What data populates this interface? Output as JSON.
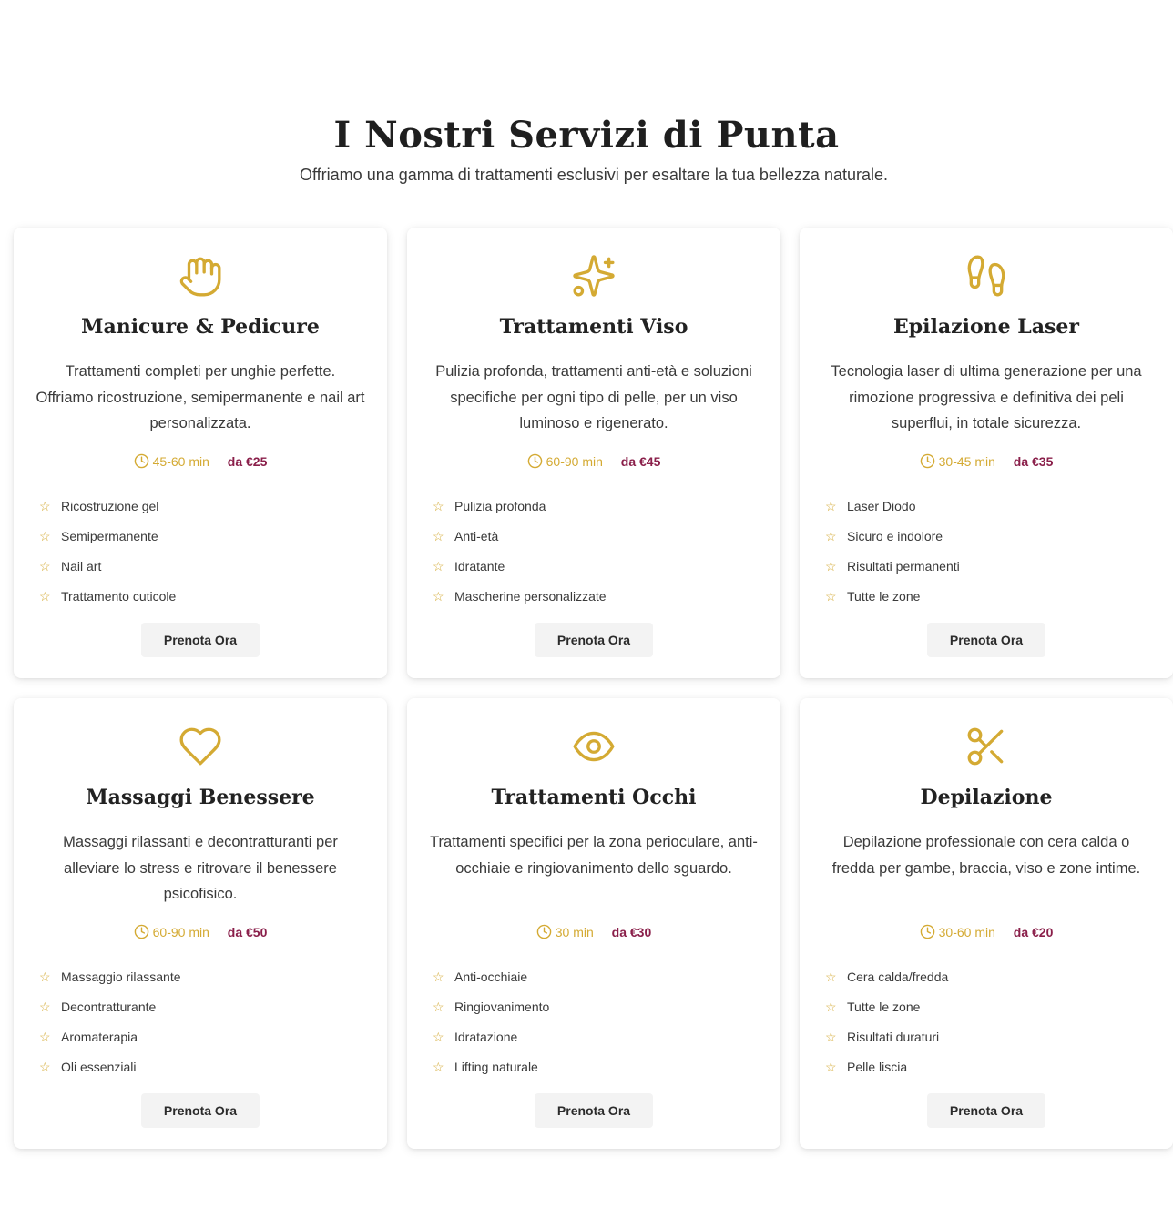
{
  "section": {
    "title": "I Nostri Servizi di Punta",
    "subtitle": "Offriamo una gamma di trattamenti esclusivi per esaltare la tua bellezza naturale."
  },
  "colors": {
    "gold": "#d4aa33",
    "price": "#8a1f4a"
  },
  "services": [
    {
      "icon": "hand-icon",
      "title": "Manicure & Pedicure",
      "description": "Trattamenti completi per unghie perfette. Offriamo ricostruzione, semipermanente e nail art personalizzata.",
      "duration": "45-60 min",
      "price": "da €25",
      "features": [
        "Ricostruzione gel",
        "Semipermanente",
        "Nail art",
        "Trattamento cuticole"
      ],
      "button": "Prenota Ora"
    },
    {
      "icon": "sparkles-icon",
      "title": "Trattamenti Viso",
      "description": "Pulizia profonda, trattamenti anti-età e soluzioni specifiche per ogni tipo di pelle, per un viso luminoso e rigenerato.",
      "duration": "60-90 min",
      "price": "da €45",
      "features": [
        "Pulizia profonda",
        "Anti-età",
        "Idratante",
        "Mascherine personalizzate"
      ],
      "button": "Prenota Ora"
    },
    {
      "icon": "footprints-icon",
      "title": "Epilazione Laser",
      "description": "Tecnologia laser di ultima generazione per una rimozione progressiva e definitiva dei peli superflui, in totale sicurezza.",
      "duration": "30-45 min",
      "price": "da €35",
      "features": [
        "Laser Diodo",
        "Sicuro e indolore",
        "Risultati permanenti",
        "Tutte le zone"
      ],
      "button": "Prenota Ora"
    },
    {
      "icon": "heart-icon",
      "title": "Massaggi Benessere",
      "description": "Massaggi rilassanti e decontratturanti per alleviare lo stress e ritrovare il benessere psicofisico.",
      "duration": "60-90 min",
      "price": "da €50",
      "features": [
        "Massaggio rilassante",
        "Decontratturante",
        "Aromaterapia",
        "Oli essenziali"
      ],
      "button": "Prenota Ora"
    },
    {
      "icon": "eye-icon",
      "title": "Trattamenti Occhi",
      "description": "Trattamenti specifici per la zona perioculare, anti-occhiaie e ringiovanimento dello sguardo.",
      "duration": "30 min",
      "price": "da €30",
      "features": [
        "Anti-occhiaie",
        "Ringiovanimento",
        "Idratazione",
        "Lifting naturale"
      ],
      "button": "Prenota Ora"
    },
    {
      "icon": "scissors-icon",
      "title": "Depilazione",
      "description": "Depilazione professionale con cera calda o fredda per gambe, braccia, viso e zone intime.",
      "duration": "30-60 min",
      "price": "da €20",
      "features": [
        "Cera calda/fredda",
        "Tutte le zone",
        "Risultati duraturi",
        "Pelle liscia"
      ],
      "button": "Prenota Ora"
    }
  ]
}
